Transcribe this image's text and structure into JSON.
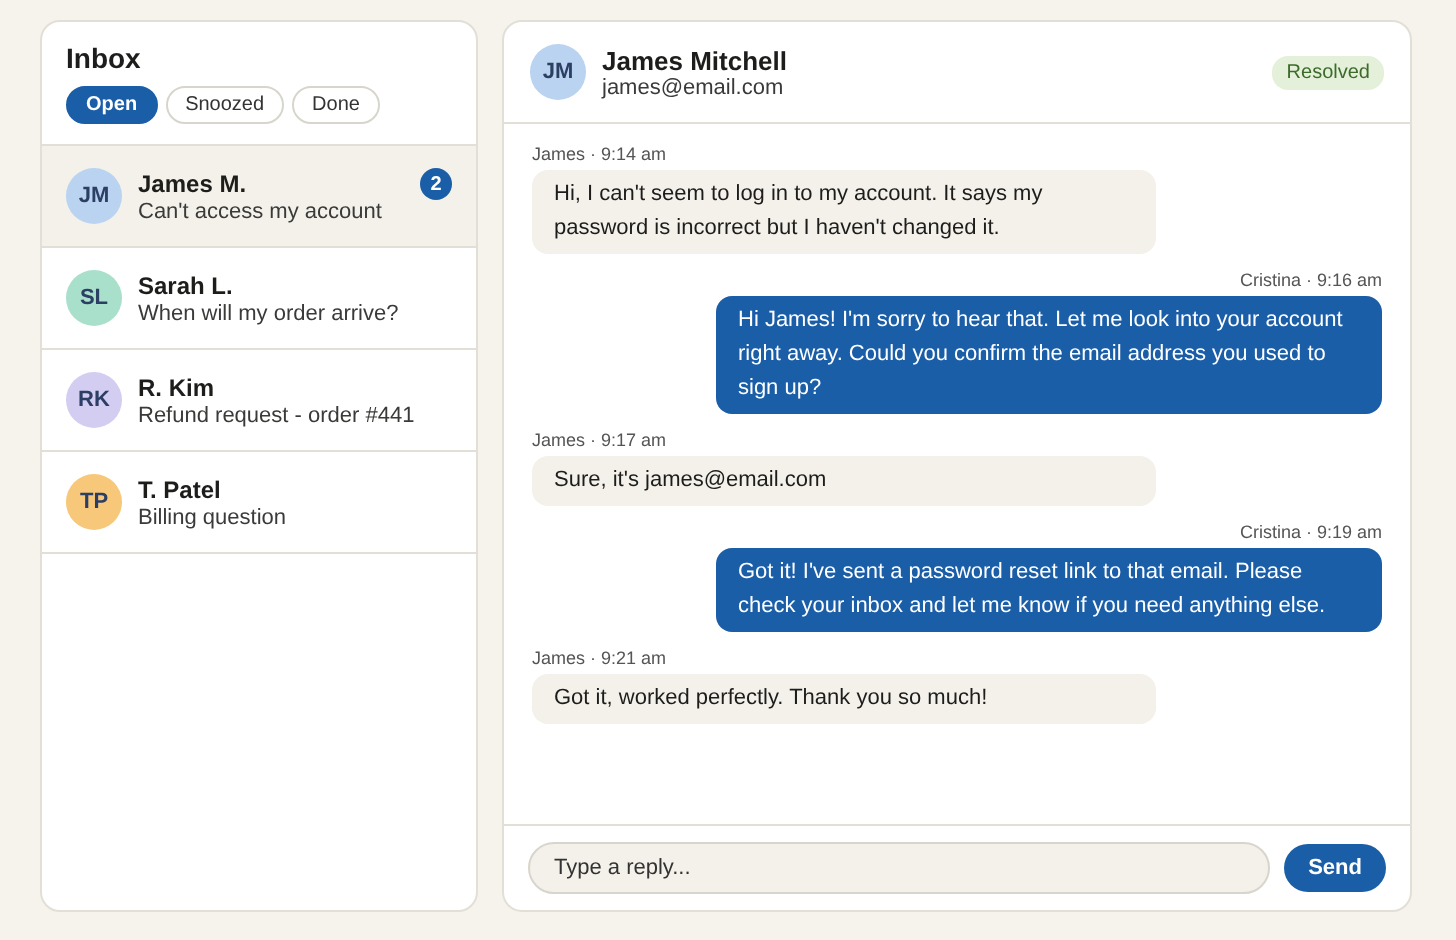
{
  "inbox": {
    "title": "Inbox",
    "filters": [
      {
        "label": "Open",
        "selected": true
      },
      {
        "label": "Snoozed",
        "selected": false
      },
      {
        "label": "Done",
        "selected": false
      }
    ],
    "conversations": [
      {
        "initials": "JM",
        "name": "James M.",
        "preview": "Can't access my account",
        "color": "#b9d3f0",
        "unread": "2",
        "selected": true
      },
      {
        "initials": "SL",
        "name": "Sarah L.",
        "preview": "When will my order arrive?",
        "color": "#a8e0cc",
        "selected": false
      },
      {
        "initials": "RK",
        "name": "R. Kim",
        "preview": "Refund request - order #441",
        "color": "#d3cdf2",
        "selected": false
      },
      {
        "initials": "TP",
        "name": "T. Patel",
        "preview": "Billing question",
        "color": "#f7c87a",
        "selected": false
      }
    ]
  },
  "conversation": {
    "initials": "JM",
    "color": "#b9d3f0",
    "name": "James Mitchell",
    "email": "james@email.com",
    "status": "Resolved",
    "messages": [
      {
        "kind": "incoming",
        "meta": "James · 9:14 am",
        "text": "Hi, I can't seem to log in to my account. It says my password is incorrect but I haven't changed it."
      },
      {
        "kind": "outgoing",
        "meta": "Cristina · 9:16 am",
        "text": "Hi James! I'm sorry to hear that. Let me look into your account right away. Could you confirm the email address you used to sign up?"
      },
      {
        "kind": "incoming",
        "meta": "James · 9:17 am",
        "text": "Sure, it's james@email.com"
      },
      {
        "kind": "outgoing",
        "meta": "Cristina · 9:19 am",
        "text": "Got it! I've sent a password reset link to that email. Please check your inbox and let me know if you need anything else."
      },
      {
        "kind": "incoming",
        "meta": "James · 9:21 am",
        "text": "Got it, worked perfectly. Thank you so much!"
      }
    ]
  },
  "composer": {
    "placeholder": "Type a reply...",
    "send": "Send"
  }
}
